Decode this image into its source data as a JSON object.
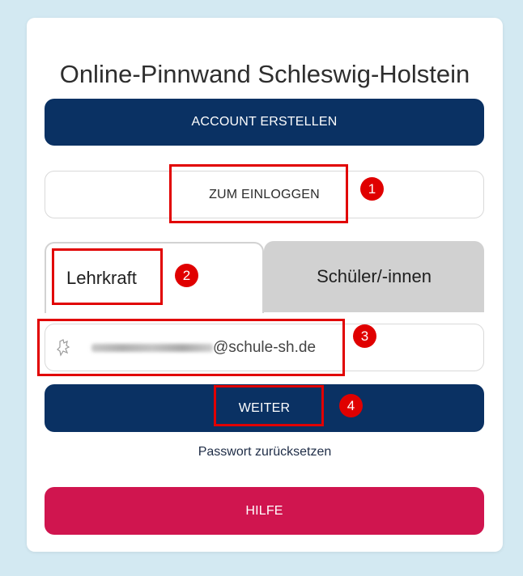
{
  "title": "Online-Pinnwand Schleswig-Holstein",
  "buttons": {
    "create": "ACCOUNT ERSTELLEN",
    "login": "ZUM EINLOGGEN",
    "next": "WEITER",
    "help": "HILFE"
  },
  "tabs": {
    "teacher": "Lehrkraft",
    "students": "Schüler/-innen"
  },
  "email_input": {
    "visible_suffix": "@schule-sh.de",
    "icon": "seal-icon"
  },
  "reset_link": "Passwort zurücksetzen",
  "annotations": [
    "1",
    "2",
    "3",
    "4"
  ],
  "colors": {
    "primary": "#0a3163",
    "help": "#d0154f",
    "highlight": "#e10000",
    "background": "#d3e9f2"
  }
}
